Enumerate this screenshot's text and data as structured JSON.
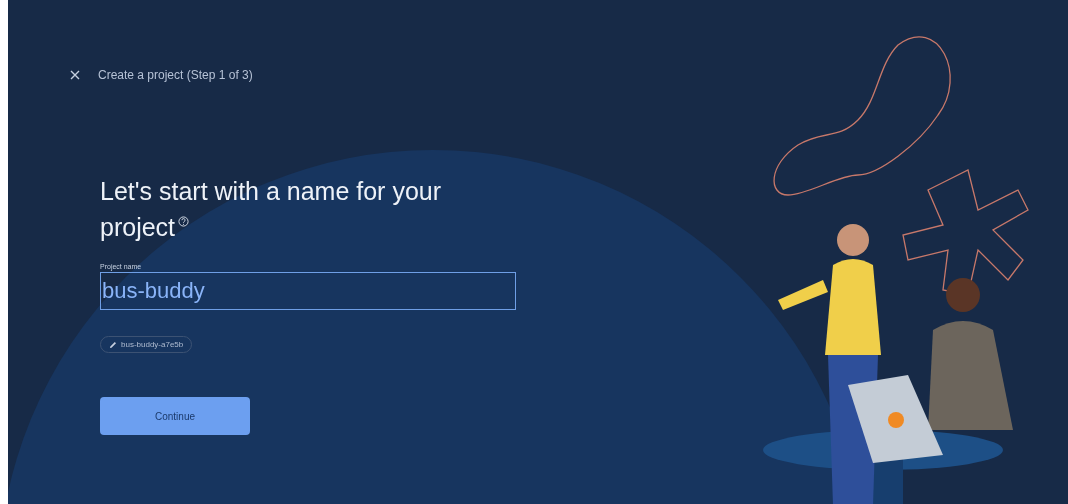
{
  "header": {
    "title": "Create a project (Step 1 of 3)"
  },
  "heading": "Let's start with a name for your project",
  "field": {
    "label": "Project name",
    "value": "bus-buddy"
  },
  "project_id": "bus-buddy-a7e5b",
  "button": {
    "label": "Continue"
  }
}
